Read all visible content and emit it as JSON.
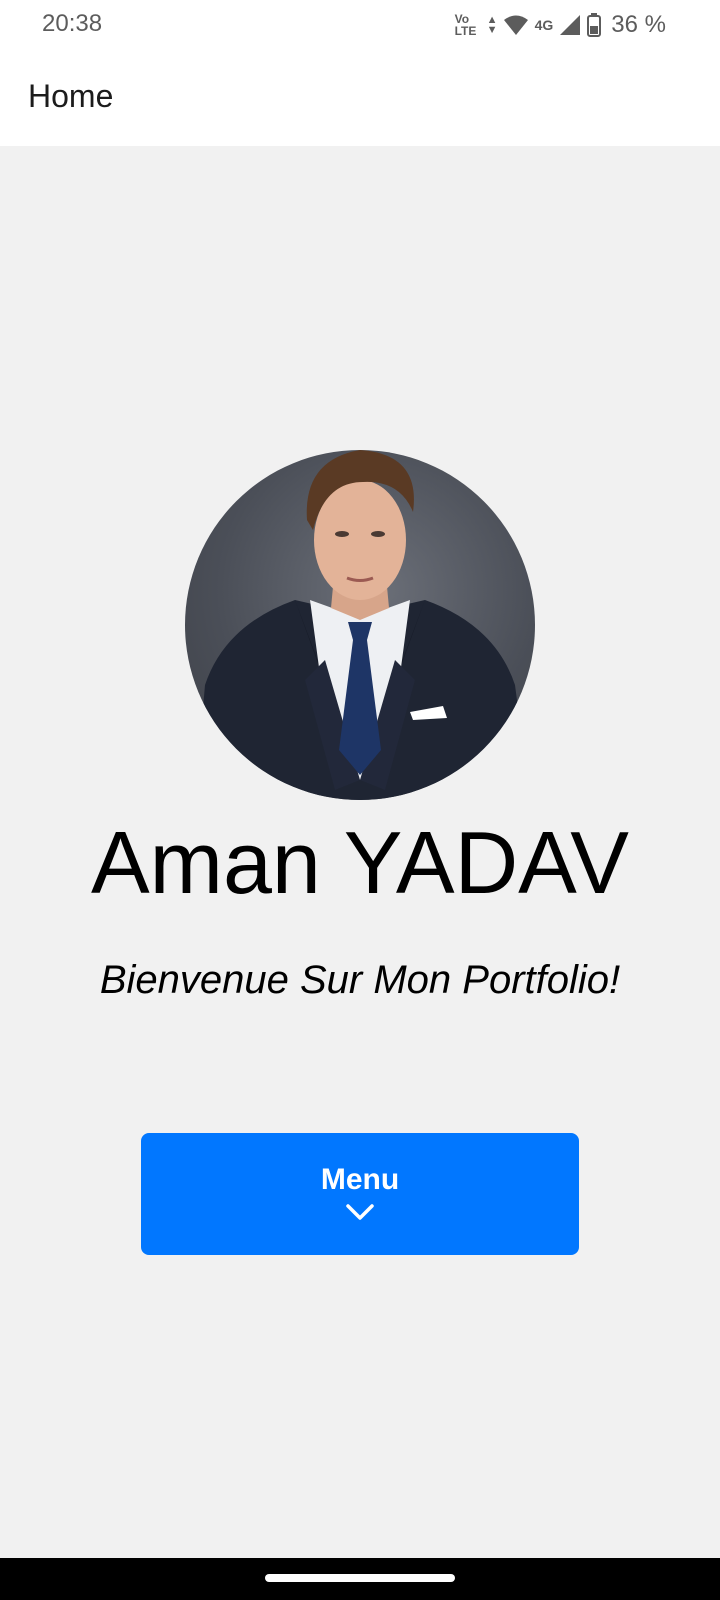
{
  "status_bar": {
    "time": "20:38",
    "volte_line1": "Vo",
    "volte_line2": "LTE",
    "network_type": "4G",
    "battery_percent": "36 %",
    "icons": [
      "volte-icon",
      "data-arrows-icon",
      "wifi-icon",
      "signal-icon",
      "battery-icon"
    ]
  },
  "app_bar": {
    "title": "Home"
  },
  "profile": {
    "name": "Aman YADAV",
    "tagline": "Bienvenue Sur Mon Portfolio!",
    "avatar_icon": "profile-photo"
  },
  "menu_button": {
    "label": "Menu",
    "icon": "chevron-down-icon",
    "color": "#0177ff"
  },
  "colors": {
    "background": "#f1f1f1",
    "bars": "#ffffff",
    "accent": "#0177ff",
    "nav_bar": "#000000"
  }
}
